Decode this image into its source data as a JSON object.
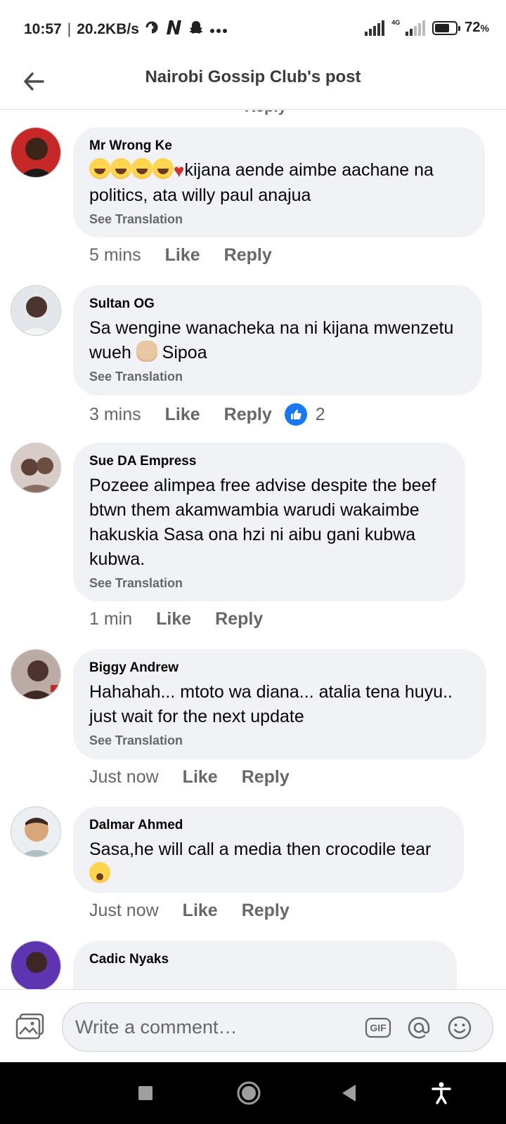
{
  "status_bar": {
    "time": "10:57",
    "speed": "20.2KB/s",
    "network": "4G",
    "battery": "72",
    "battery_unit": "%",
    "battery_level": 0.72,
    "notification_icons": [
      "swirl-icon",
      "netflix-n-icon",
      "snapchat-ghost-icon",
      "more-dots-icon"
    ]
  },
  "header": {
    "title": "Nairobi Gossip Club's post"
  },
  "clipped_action": "Reply",
  "comments": [
    {
      "author": "Mr Wrong Ke",
      "text": "kijana aende aimbe aachane na politics, ata willy paul anajua",
      "emoji_prefix": [
        "tears-of-joy-emoji",
        "tears-of-joy-emoji",
        "tears-of-joy-emoji",
        "tears-of-joy-emoji",
        "broken-heart-emoji"
      ],
      "see_translation": "See Translation",
      "time": "5 mins",
      "like": "Like",
      "reply": "Reply"
    },
    {
      "author": "Sultan OG",
      "text_before": "Sa wengine wanacheka na ni kijana mwenzetu wueh",
      "text_after": "Sipoa",
      "emoji_inline": "facepalm-emoji",
      "see_translation": "See Translation",
      "time": "3 mins",
      "like": "Like",
      "reply": "Reply",
      "reaction_count": "2"
    },
    {
      "author": "Sue DA Empress",
      "text": "Pozeee alimpea free advise despite the beef btwn them akamwambia warudi wakaimbe hakuskia Sasa ona hzi ni aibu gani kubwa kubwa.",
      "see_translation": "See Translation",
      "time": "1 min",
      "like": "Like",
      "reply": "Reply"
    },
    {
      "author": "Biggy Andrew",
      "text": "Hahahah... mtoto wa diana... atalia tena huyu.. just wait for the next update",
      "see_translation": "See Translation",
      "time": "Just now",
      "like": "Like",
      "reply": "Reply"
    },
    {
      "author": "Dalmar Ahmed",
      "text": "Sasa,he will call a media then crocodile tear",
      "emoji_suffix": "loudly-crying-emoji",
      "time": "Just now",
      "like": "Like",
      "reply": "Reply"
    },
    {
      "author": "Cadic Nyaks"
    }
  ],
  "composer": {
    "placeholder": "Write a comment…",
    "gif_label": "GIF"
  },
  "colors": {
    "bubble": "#f0f2f5",
    "secondary_text": "#65676b",
    "facebook_blue": "#1877f2"
  }
}
